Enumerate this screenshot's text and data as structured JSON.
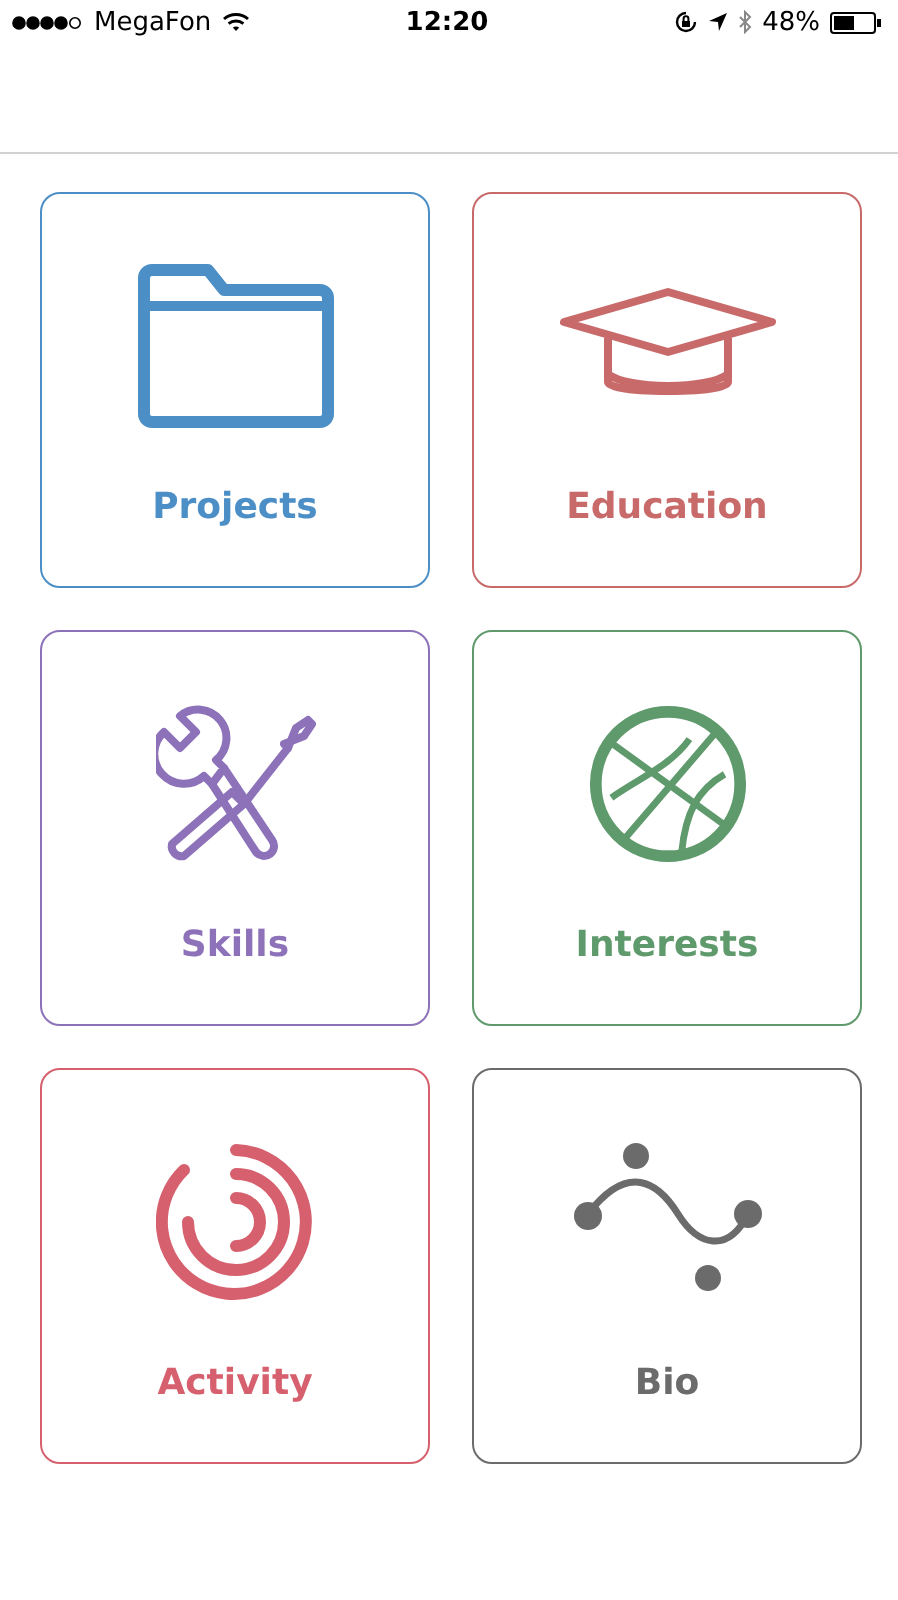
{
  "status_bar": {
    "carrier": "MegaFon",
    "time": "12:20",
    "battery": "48%"
  },
  "tiles": [
    {
      "label": "Projects",
      "kind": "folder",
      "color": "#4b8fc6"
    },
    {
      "label": "Education",
      "kind": "cap",
      "color": "#c86a6a"
    },
    {
      "label": "Skills",
      "kind": "tools",
      "color": "#8d72b9"
    },
    {
      "label": "Interests",
      "kind": "ball",
      "color": "#5f9a6c"
    },
    {
      "label": "Activity",
      "kind": "rings",
      "color": "#d6606e"
    },
    {
      "label": "Bio",
      "kind": "curve",
      "color": "#6b6b6b"
    }
  ]
}
